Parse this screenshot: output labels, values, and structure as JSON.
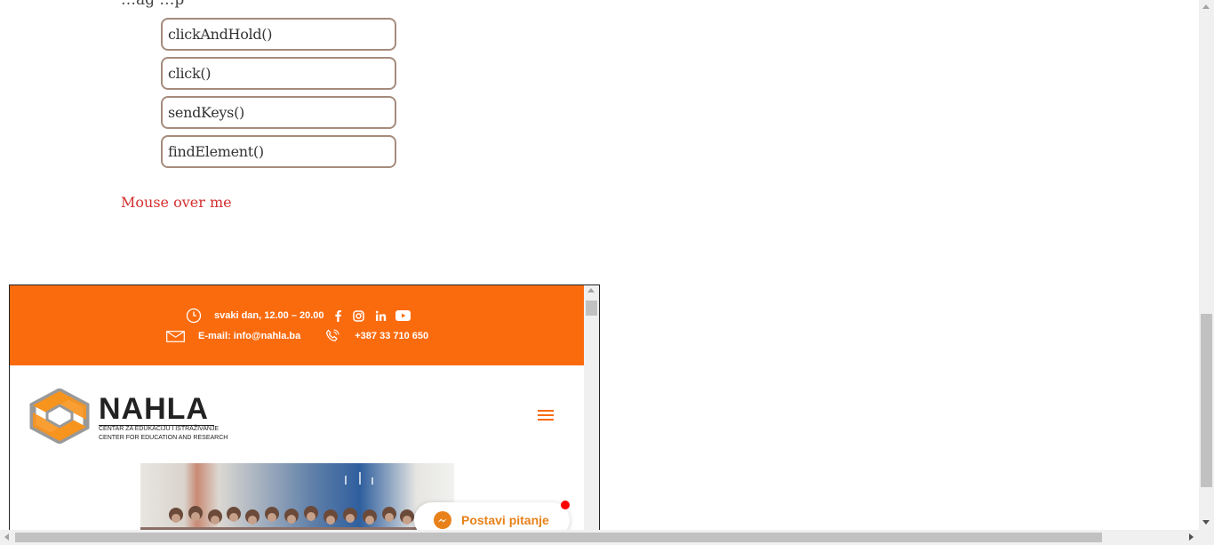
{
  "page": {
    "cut_text": "…ag   …p",
    "buttons": [
      "clickAndHold()",
      "click()",
      "sendKeys()",
      "findElement()"
    ],
    "mouse_over": "Mouse over me"
  },
  "iframe": {
    "topbar": {
      "hours": "svaki dan, 12.00 – 20.00",
      "email": "E-mail: info@nahla.ba",
      "phone": "+387 33 710 650",
      "social_icons": [
        "facebook-icon",
        "instagram-icon",
        "linkedin-icon",
        "youtube-icon"
      ],
      "bg_color": "#fa6b0e"
    },
    "logo": {
      "name": "NAHLA",
      "sub1": "CENTAR ZA EDUKACIJU I ISTRAŽIVANJE",
      "sub2": "CENTER FOR EDUCATION AND RESEARCH"
    },
    "chat": {
      "label": "Postavi pitanje"
    }
  }
}
